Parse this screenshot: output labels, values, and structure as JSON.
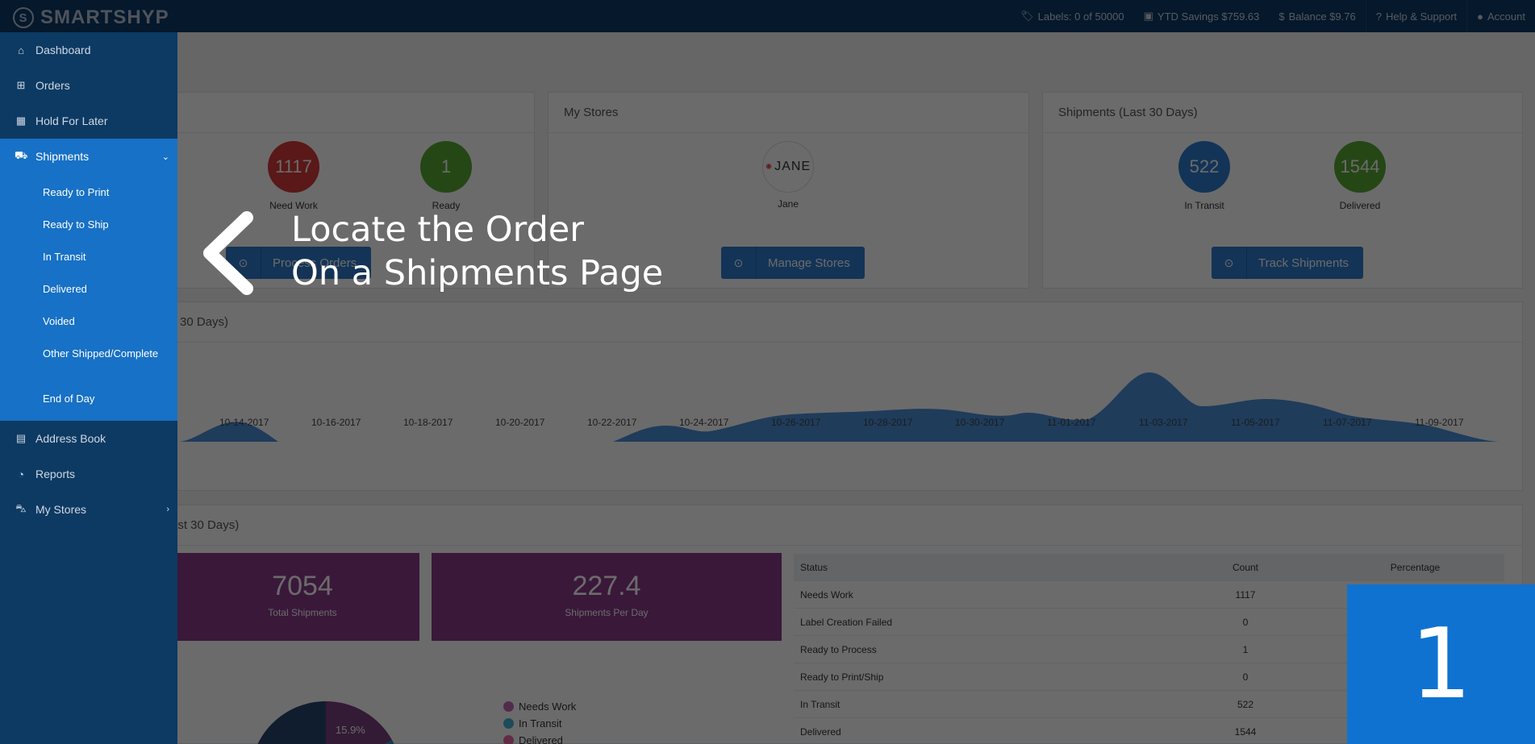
{
  "header": {
    "brand": "SMARTSHYP",
    "labels": "Labels: 0 of 50000",
    "ytd_savings": "YTD Savings $759.63",
    "balance": "Balance $9.76",
    "help": "Help & Support",
    "account": "Account"
  },
  "sidebar": {
    "items": [
      {
        "label": "Dashboard",
        "icon": "home-icon"
      },
      {
        "label": "Orders",
        "icon": "basket-icon"
      },
      {
        "label": "Hold For Later",
        "icon": "calendar-icon"
      },
      {
        "label": "Shipments",
        "icon": "truck-icon"
      },
      {
        "label": "Address Book",
        "icon": "address-book-icon"
      },
      {
        "label": "Reports",
        "icon": "pie-chart-icon"
      },
      {
        "label": "My Stores",
        "icon": "cart-icon"
      }
    ],
    "shipments_sub": [
      "Ready to Print",
      "Ready to Ship",
      "In Transit",
      "Delivered",
      "Voided",
      "Other Shipped/Complete",
      "End of Day"
    ]
  },
  "orders_panel": {
    "need_work_value": "1117",
    "need_work_label": "Need Work",
    "ready_value": "1",
    "ready_label": "Ready",
    "button": "Process Orders"
  },
  "stores_panel": {
    "title": "My Stores",
    "store_logo": "JANE",
    "store_name": "Jane",
    "button": "Manage Stores"
  },
  "shipments_panel": {
    "title": "Shipments (Last 30 Days)",
    "in_transit_value": "522",
    "in_transit_label": "In Transit",
    "delivered_value": "1544",
    "delivered_label": "Delivered",
    "button": "Track Shipments"
  },
  "chart": {
    "title_visible": "30 Days)",
    "x_ticks": [
      "10-14-2017",
      "10-16-2017",
      "10-18-2017",
      "10-20-2017",
      "10-22-2017",
      "10-24-2017",
      "10-26-2017",
      "10-28-2017",
      "10-30-2017",
      "11-01-2017",
      "11-03-2017",
      "11-05-2017",
      "11-07-2017",
      "11-09-2017"
    ]
  },
  "stats": {
    "title_visible": "ast 30 Days)",
    "total_value": "7054",
    "total_label": "Total Shipments",
    "per_day_value": "227.4",
    "per_day_label": "Shipments Per Day",
    "pie_label": "15.9%",
    "legend": [
      {
        "label": "Needs Work",
        "color": "#c468b5"
      },
      {
        "label": "In Transit",
        "color": "#47b3d6"
      },
      {
        "label": "Delivered",
        "color": "#e96aa3"
      }
    ],
    "table_header": [
      "Status",
      "Count",
      "Percentage"
    ],
    "table_rows": [
      [
        "Needs Work",
        "1117"
      ],
      [
        "Label Creation Failed",
        "0"
      ],
      [
        "Ready to Process",
        "1"
      ],
      [
        "Ready to Print/Ship",
        "0"
      ],
      [
        "In Transit",
        "522"
      ],
      [
        "Delivered",
        "1544"
      ]
    ]
  },
  "tutorial": {
    "line1": "Locate the Order",
    "line2": "On a Shipments Page",
    "step": "1"
  }
}
